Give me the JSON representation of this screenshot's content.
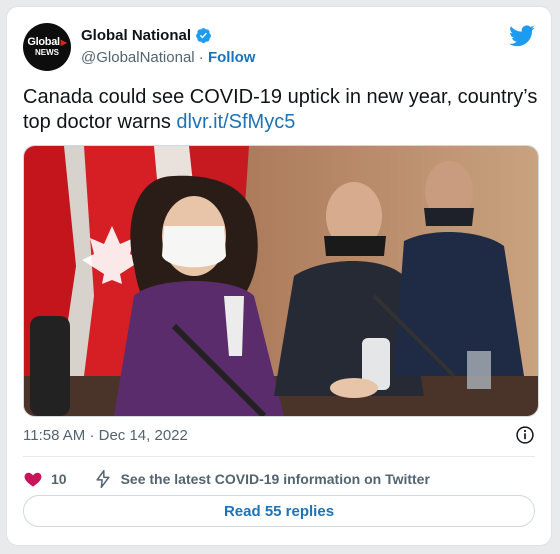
{
  "author": {
    "avatar_line1": "Global",
    "avatar_line2": "NEWS",
    "name": "Global National",
    "handle": "@GlobalNational",
    "separator": "·",
    "follow_label": "Follow"
  },
  "tweet": {
    "text": "Canada could see COVID-19 uptick in new year, country’s top doctor warns ",
    "link": "dlvr.it/SfMyc5"
  },
  "meta": {
    "time": "11:58 AM",
    "separator": "·",
    "date": "Dec 14, 2022"
  },
  "actions": {
    "likes": "10",
    "covid_info": "See the latest COVID-19 information on Twitter"
  },
  "read_replies": "Read 55 replies",
  "colors": {
    "brand_blue": "#1d9bf0",
    "link_blue": "#1d73b8",
    "heart": "#c9135a"
  },
  "icons": {
    "verified": "verified-badge-icon",
    "twitter": "twitter-bird-icon",
    "info": "info-icon",
    "heart": "heart-icon",
    "bolt": "lightning-icon"
  }
}
